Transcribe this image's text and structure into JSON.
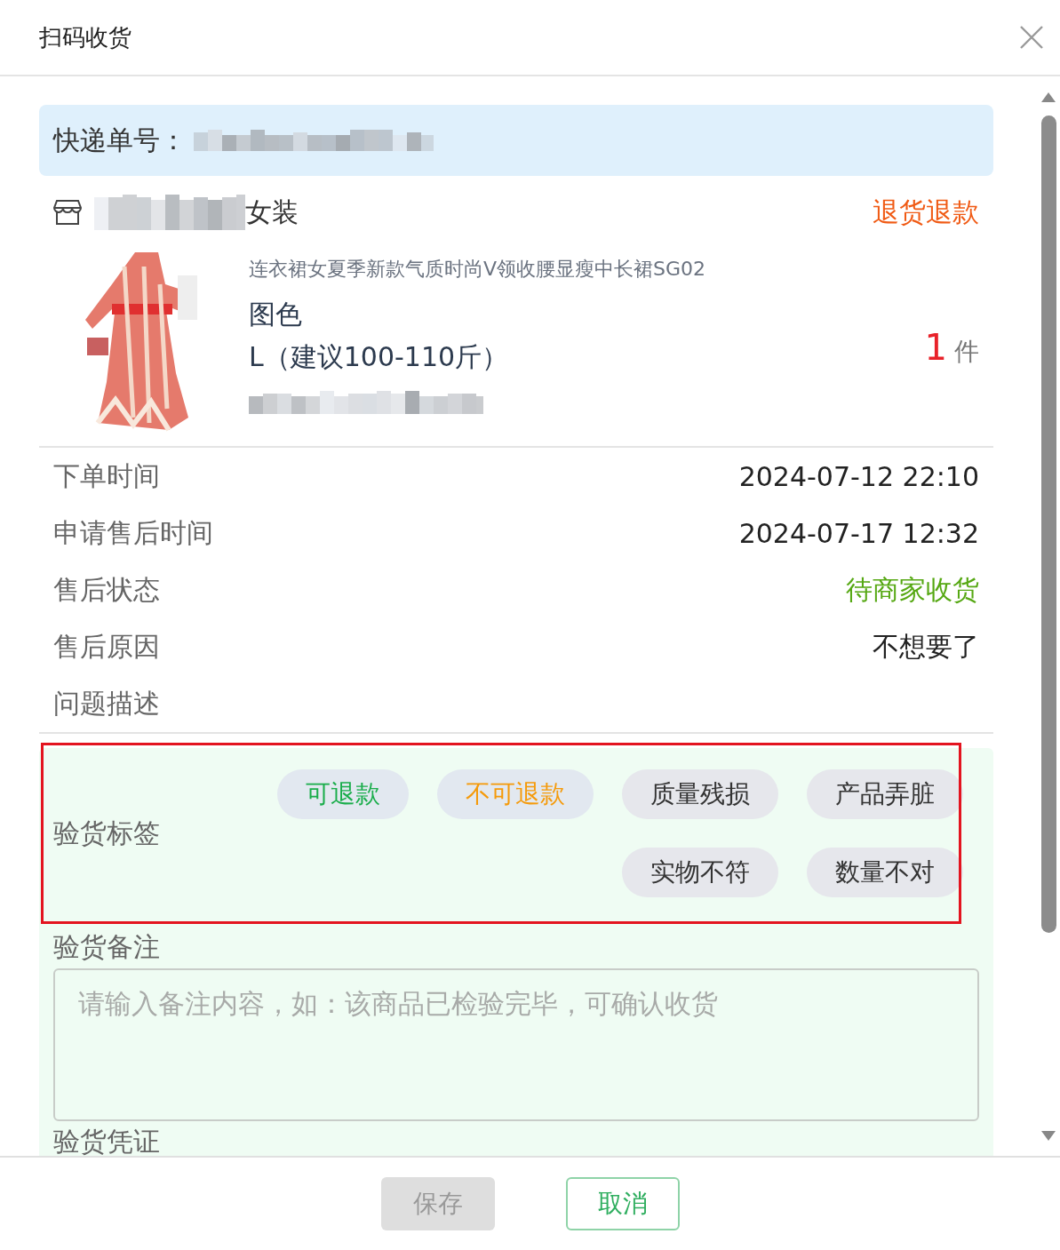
{
  "dialog": {
    "title": "扫码收货"
  },
  "express": {
    "label": "快递单号："
  },
  "shop": {
    "name_suffix": "女装",
    "status": "退货退款"
  },
  "product": {
    "kind": "picture",
    "title": "连衣裙女夏季新款气质时尚V领收腰显瘦中长裙SG02",
    "variant": "图色",
    "size": "L（建议100-110斤）",
    "quantity": "1",
    "unit": "件"
  },
  "info_rows": [
    {
      "label": "下单时间",
      "value": "2024-07-12 22:10",
      "kind": "plain"
    },
    {
      "label": "申请售后时间",
      "value": "2024-07-17 12:32",
      "kind": "plain"
    },
    {
      "label": "售后状态",
      "value": "待商家收货",
      "kind": "status"
    },
    {
      "label": "售后原因",
      "value": "不想要了",
      "kind": "plain"
    },
    {
      "label": "问题描述",
      "kind": "plain"
    }
  ],
  "inspection": {
    "tags_label": "验货标签",
    "highlighted": true,
    "tags": [
      {
        "label": "可退款",
        "color": "#1aad4b"
      },
      {
        "label": "不可退款",
        "color": "#f59a0a"
      },
      {
        "label": "质量残损",
        "color": "#333333"
      },
      {
        "label": "产品弄脏",
        "color": "#333333"
      },
      {
        "label": "实物不符",
        "color": "#333333"
      },
      {
        "label": "数量不对",
        "color": "#333333"
      }
    ],
    "remark_label": "验货备注",
    "remark_placeholder": "请输入备注内容，如：该商品已检验完毕，可确认收货",
    "proof_label": "验货凭证"
  },
  "buttons": [
    {
      "label": "保存",
      "kind": "save",
      "disabled": true
    },
    {
      "label": "取消",
      "kind": "cancel",
      "disabled": false
    }
  ]
}
